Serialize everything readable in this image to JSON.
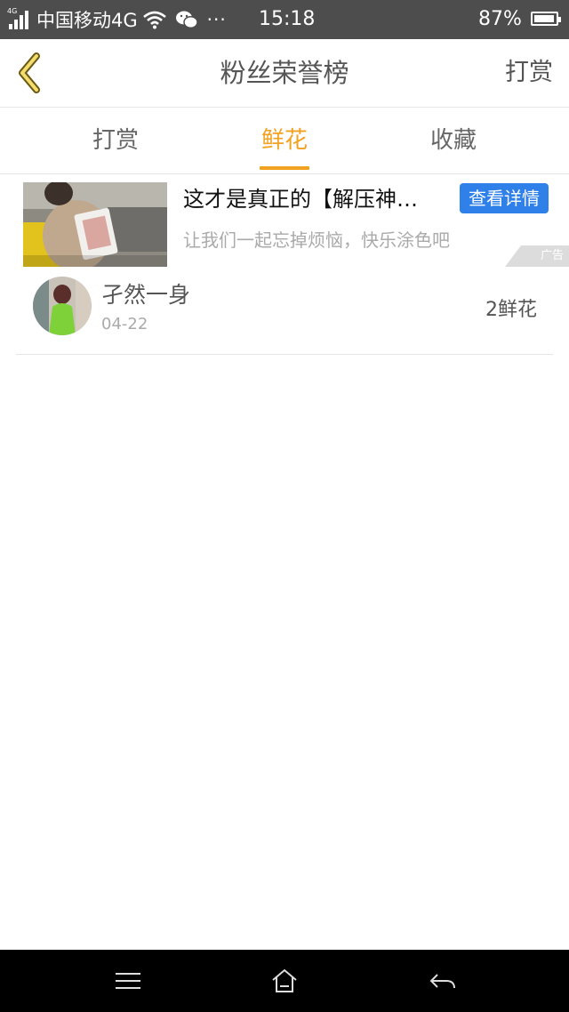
{
  "status_bar": {
    "network_tag": "4G",
    "carrier": "中国移动4G",
    "dots": "···",
    "time": "15:18",
    "battery": "87%"
  },
  "nav": {
    "title": "粉丝荣誉榜",
    "action": "打赏"
  },
  "tabs": [
    {
      "label": "打赏",
      "active": false
    },
    {
      "label": "鲜花",
      "active": true
    },
    {
      "label": "收藏",
      "active": false
    }
  ],
  "ad": {
    "title": "这才是真正的【解压神…",
    "description": "让我们一起忘掉烦恼，快乐涂色吧",
    "button": "查看详情",
    "label": "广告"
  },
  "fans": [
    {
      "name": "孑然一身",
      "date": "04-22",
      "amount": "2鲜花"
    }
  ],
  "colors": {
    "accent": "#f1a223",
    "ad_button": "#2f80e8",
    "status_bar": "#4d4d4d"
  }
}
